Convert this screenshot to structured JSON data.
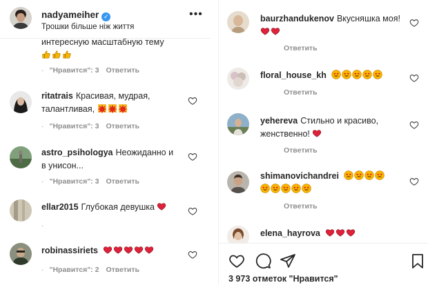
{
  "header": {
    "username": "nadyameiher",
    "bio": "Трошки більше ніж життя",
    "more_glyph": "•••",
    "verified_glyph": "✓"
  },
  "left_comments": [
    {
      "username": "",
      "text": "интересную масштабную тему",
      "reactions": 3,
      "meta_likes": "\"Нравится\": 3",
      "reply": "Ответить"
    },
    {
      "username": "ritatrais",
      "text": "Красивая, мудрая, талантливая,",
      "meta_likes": "\"Нравится\": 3",
      "reply": "Ответить"
    },
    {
      "username": "astro_psihologya",
      "text": "Неожиданно и в унисон...",
      "meta_likes": "\"Нравится\": 3",
      "reply": "Ответить"
    },
    {
      "username": "ellar2015",
      "text": "Глубокая девушка",
      "meta_likes": "",
      "reply": ""
    },
    {
      "username": "robinassiriets",
      "text": "",
      "meta_likes": "\"Нравится\": 2",
      "reply": "Ответить"
    }
  ],
  "right_comments": [
    {
      "username": "baurzhandukenov",
      "text": "Вкусняшка моя!",
      "reply": "Ответить"
    },
    {
      "username": "floral_house_kh",
      "text": "",
      "reply": "Ответить"
    },
    {
      "username": "yehereva",
      "text": "Стильно и красиво, женственно!",
      "reply": "Ответить"
    },
    {
      "username": "shimanovichandrei",
      "text": "",
      "reply": "Ответить"
    },
    {
      "username": "elena_hayrova",
      "text": ""
    }
  ],
  "likes_text": "3 973 отметок \"Нравится\"",
  "colors": {
    "verified": "#3897f0",
    "heart_red": "#ed4956",
    "muted": "#8e8e8e"
  }
}
